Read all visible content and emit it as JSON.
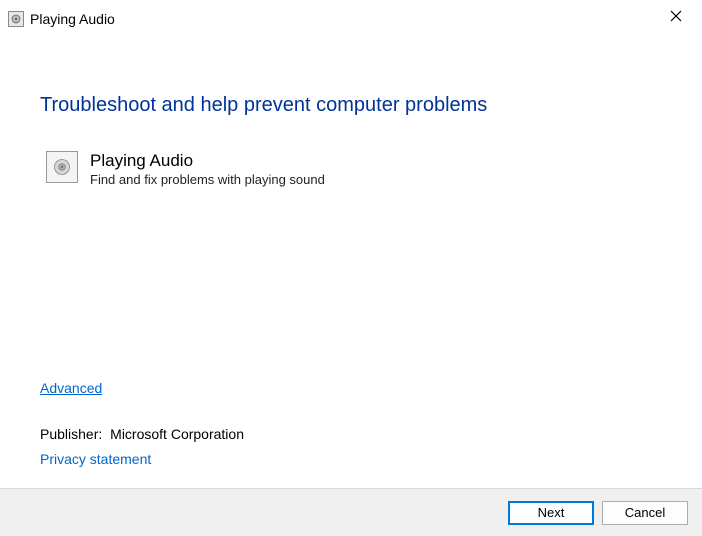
{
  "window": {
    "title": "Playing Audio"
  },
  "main": {
    "heading": "Troubleshoot and help prevent computer problems",
    "item": {
      "title": "Playing Audio",
      "description": "Find and fix problems with playing sound"
    }
  },
  "links": {
    "advanced": "Advanced",
    "privacy": "Privacy statement"
  },
  "publisher": {
    "label": "Publisher:",
    "value": "Microsoft Corporation"
  },
  "footer": {
    "next": "Next",
    "cancel": "Cancel"
  }
}
